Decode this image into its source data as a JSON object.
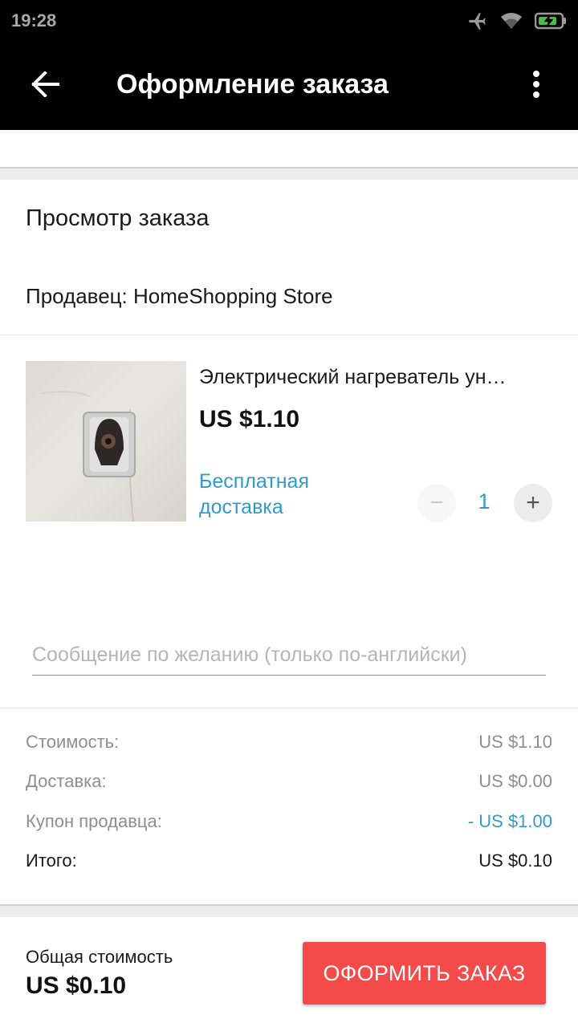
{
  "status_bar": {
    "time": "19:28",
    "icons": [
      "airplane-icon",
      "wifi-icon",
      "battery-charging-icon"
    ]
  },
  "app_bar": {
    "title": "Оформление заказа",
    "back_icon": "arrow-left-icon",
    "menu_icon": "more-vertical-icon"
  },
  "order": {
    "section_title": "Просмотр заказа",
    "seller": "Продавец: HomeShopping Store",
    "product": {
      "name": "Электрический нагреватель ун…",
      "price": "US $1.10",
      "shipping": "Бесплатная доставка",
      "quantity": "1",
      "minus_symbol": "−",
      "plus_symbol": "+"
    },
    "message_placeholder": "Сообщение по желанию (только по-английски)"
  },
  "summary": {
    "rows": [
      {
        "label": "Стоимость:",
        "value": "US $1.10"
      },
      {
        "label": "Доставка:",
        "value": "US $0.00"
      },
      {
        "label": "Купон продавца:",
        "value": "- US $1.00"
      },
      {
        "label": "Итого:",
        "value": "US $0.10"
      }
    ]
  },
  "footer": {
    "total_label": "Общая стоимость",
    "total_value": "US $0.10",
    "checkout_label": "ОФОРМИТЬ ЗАКАЗ"
  },
  "colors": {
    "accent_blue": "#2f9bc8",
    "checkout_red": "#f44a4a",
    "app_bar": "#000000"
  }
}
